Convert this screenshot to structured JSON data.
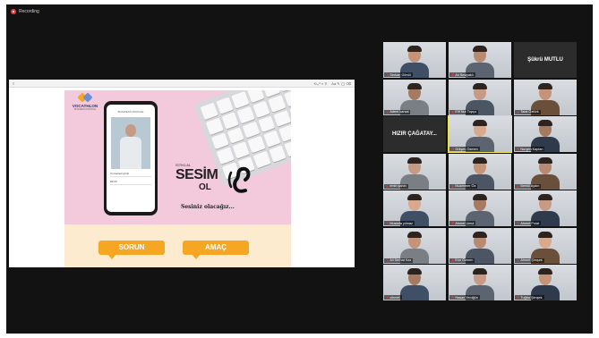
{
  "recording": {
    "label": "Recording"
  },
  "browser": {
    "icons": "⟲  ⤢  ⌕  ⚲",
    "tools": "Aa  ✎  ◯  ⌫"
  },
  "document": {
    "logo_name": "VOCATHLON",
    "logo_sub": "BUSINESS PROFILE",
    "phone_header": "BUSINESS PROFILE",
    "phone_row_1": "Cumartesi günü",
    "phone_row_2": "09:00",
    "brand_small": "İSTİKLAL",
    "brand_title": "SESİM",
    "brand_ol": "OL",
    "slogan": "Sesiniz olacağız...",
    "button_left": "SORUN",
    "button_right": "AMAÇ",
    "colors": {
      "pink": "#f3c9dc",
      "orange": "#f5a623",
      "cream": "#fdebd0"
    }
  },
  "participants": [
    {
      "name": "Serkan Gönül",
      "type": "video",
      "col": 0,
      "row": 0
    },
    {
      "name": "Ali Sesiyaklı",
      "type": "video",
      "col": 1,
      "row": 0
    },
    {
      "name": "Şükrü MUTLU",
      "type": "name-only",
      "col": 2,
      "row": 0
    },
    {
      "name": "Adem karsal",
      "type": "video",
      "col": 0,
      "row": 1
    },
    {
      "name": "Elif Nur Topçu",
      "type": "video",
      "col": 1,
      "row": 1
    },
    {
      "name": "Talat Öztürk",
      "type": "video",
      "col": 2,
      "row": 1
    },
    {
      "name": "HIZIR ÇAĞATAY...",
      "type": "name-only",
      "col": 0,
      "row": 2
    },
    {
      "name": "Gülşen Özmen",
      "type": "video",
      "col": 1,
      "row": 2,
      "active": true
    },
    {
      "name": "Nurşen Kaplan",
      "type": "video",
      "col": 2,
      "row": 2
    },
    {
      "name": "emin şahin",
      "type": "video",
      "col": 0,
      "row": 3
    },
    {
      "name": "Muammer Öz",
      "type": "video",
      "col": 1,
      "row": 3
    },
    {
      "name": "Behlül Aydın",
      "type": "video",
      "col": 2,
      "row": 3
    },
    {
      "name": "Mustafa yılmaz",
      "type": "video",
      "col": 0,
      "row": 4
    },
    {
      "name": "Ahmet Umut",
      "type": "video",
      "col": 1,
      "row": 4
    },
    {
      "name": "Ahmet Polat",
      "type": "video",
      "col": 2,
      "row": 4
    },
    {
      "name": "Ali Serhat Kaz",
      "type": "video",
      "col": 0,
      "row": 5
    },
    {
      "name": "Erol Özmen",
      "type": "video",
      "col": 1,
      "row": 5
    },
    {
      "name": "Ahmet Şimşek",
      "type": "video",
      "col": 2,
      "row": 5
    },
    {
      "name": "cihmet",
      "type": "video",
      "col": 0,
      "row": 6
    },
    {
      "name": "Hasan Yeniğün",
      "type": "video",
      "col": 1,
      "row": 6
    },
    {
      "name": "Tuğba Şimşek",
      "type": "video",
      "col": 2,
      "row": 6
    }
  ]
}
